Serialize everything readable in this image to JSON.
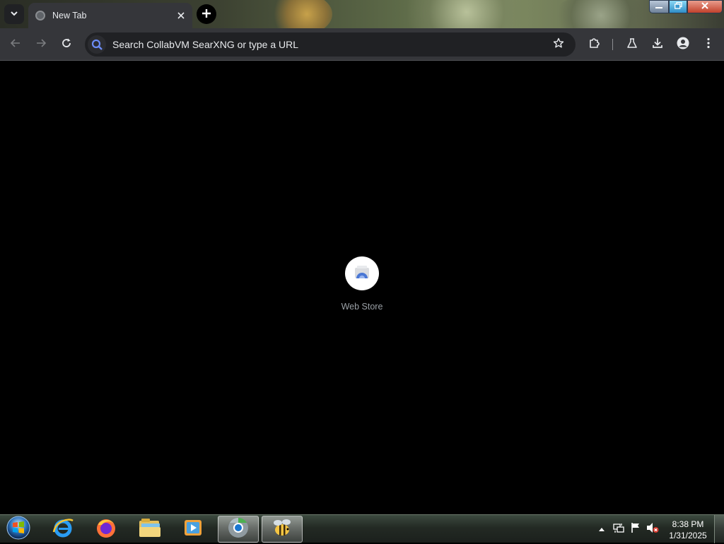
{
  "browser": {
    "tab": {
      "title": "New Tab"
    },
    "omnibox": {
      "placeholder": "Search CollabVM SearXNG or type a URL"
    }
  },
  "newtab": {
    "shortcuts": [
      {
        "label": "Web Store"
      }
    ]
  },
  "taskbar": {
    "apps": [
      {
        "name": "internet-explorer",
        "active": false
      },
      {
        "name": "firefox",
        "active": false
      },
      {
        "name": "file-explorer",
        "active": false
      },
      {
        "name": "media-player",
        "active": false
      },
      {
        "name": "chrome-browser",
        "active": true
      },
      {
        "name": "bee-app",
        "active": true
      }
    ],
    "clock": {
      "time": "8:38 PM",
      "date": "1/31/2025"
    }
  },
  "colors": {
    "toolbar_bg": "#35363a",
    "omnibox_bg": "#202124",
    "content_bg": "#000000",
    "text": "#e8eaed",
    "shortcut_label": "#9aa0a6"
  }
}
